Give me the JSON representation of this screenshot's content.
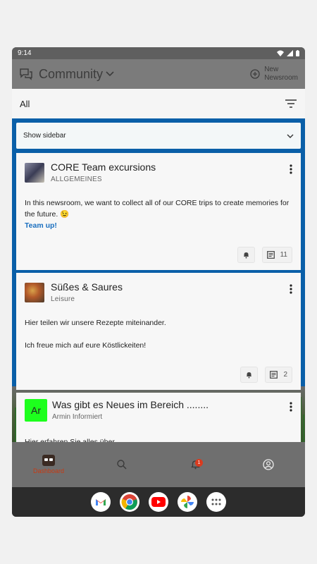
{
  "status": {
    "time": "9:14"
  },
  "appbar": {
    "title": "Community",
    "new_newsroom_line1": "New",
    "new_newsroom_line2": "Newsroom"
  },
  "filter": {
    "label": "All"
  },
  "sidebar": {
    "label": "Show sidebar"
  },
  "cards": [
    {
      "title": "CORE Team excursions",
      "subtitle": "ALLGEMEINES",
      "body1": "In this newsroom, we want to collect all of our CORE trips to create memories for the future. 😉",
      "link": "Team up!",
      "comment_count": "11"
    },
    {
      "title": "Süßes & Saures",
      "subtitle": "Leisure",
      "body1": "Hier teilen wir unsere Rezepte miteinander.",
      "body2": "Ich freue mich auf eure Köstlickeiten!",
      "comment_count": "2"
    },
    {
      "avatar_initials": "Ar",
      "title": "Was gibt es Neues im Bereich ........",
      "subtitle": "Armin Informiert",
      "body1": "Hier erfahren Sie alles über"
    }
  ],
  "bottomnav": {
    "dashboard_label": "Dashboard",
    "notification_count": "1"
  },
  "colors": {
    "accent": "#c83a12",
    "link": "#1a6fbf",
    "frame": "#0a5fa8",
    "avatar_bg": "#1dff1d"
  },
  "dock": [
    "gmail-icon",
    "chrome-icon",
    "youtube-icon",
    "photos-icon",
    "apps-icon"
  ]
}
